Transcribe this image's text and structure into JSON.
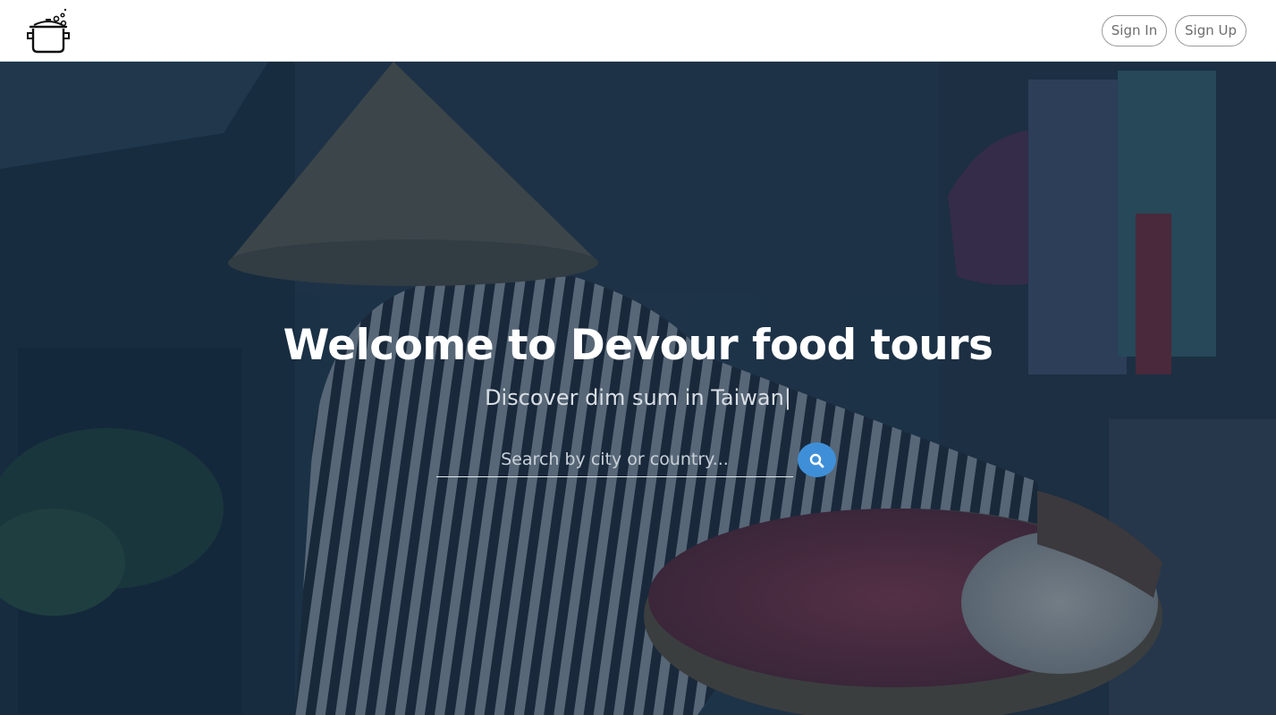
{
  "nav": {
    "logo_icon": "cooking-pot-icon",
    "sign_in_label": "Sign In",
    "sign_up_label": "Sign Up"
  },
  "hero": {
    "title": "Welcome to Devour food tours",
    "subtitle": "Discover dim sum in Taiwan",
    "cursor": "|",
    "search": {
      "placeholder": "Search by city or country...",
      "value": "",
      "button_icon": "search-icon",
      "button_color": "#3f8fd8"
    }
  },
  "colors": {
    "overlay": "#1c3247",
    "accent": "#3f8fd8"
  }
}
